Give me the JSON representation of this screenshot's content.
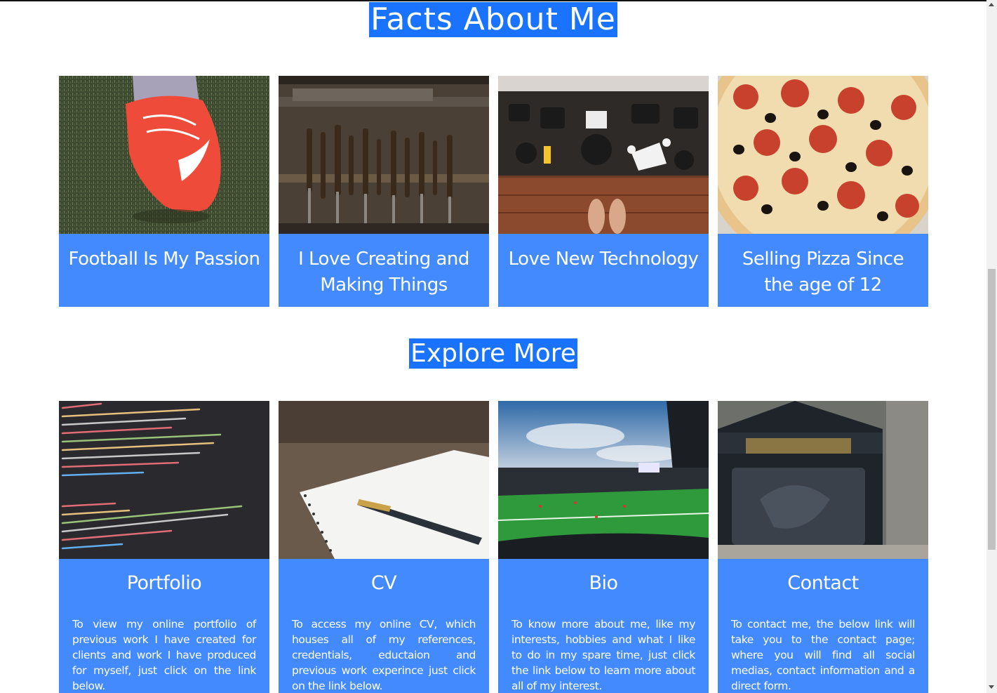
{
  "facts": {
    "title": "Facts About Me",
    "cards": [
      {
        "caption": "Football Is My Passion",
        "image": "football-boot-photo"
      },
      {
        "caption": "I Love Creating and Making Things",
        "image": "workshop-tools-photo"
      },
      {
        "caption": "Love New Technology",
        "image": "camera-gear-photo"
      },
      {
        "caption": "Selling Pizza Since the age of 12",
        "image": "pepperoni-pizza-photo"
      }
    ]
  },
  "explore": {
    "title": "Explore More",
    "cards": [
      {
        "title": "Portfolio",
        "text": "To view my online portfolio of previous work I have created for clients and work I have produced for myself, just click on the link below.",
        "image": "code-screen-photo"
      },
      {
        "title": "CV",
        "text": "To access my online CV, which houses all of my references, credentials, eductaion and previous work experince just click on the link below.",
        "image": "notebook-pen-photo"
      },
      {
        "title": "Bio",
        "text": "To know more about me, like my interests, hobbies and what I like to do in my spare time, just click the link below to learn more about all of my interest.",
        "image": "football-stadium-photo"
      },
      {
        "title": "Contact",
        "text": "To contact me, the below link will take you to the contact page; where you will find all social medias, contact information and a direct form.",
        "image": "letterbox-photo"
      }
    ]
  },
  "colors": {
    "accent": "#448aff",
    "title_highlight": "#1a73ff",
    "text_on_accent": "#ffffff"
  }
}
